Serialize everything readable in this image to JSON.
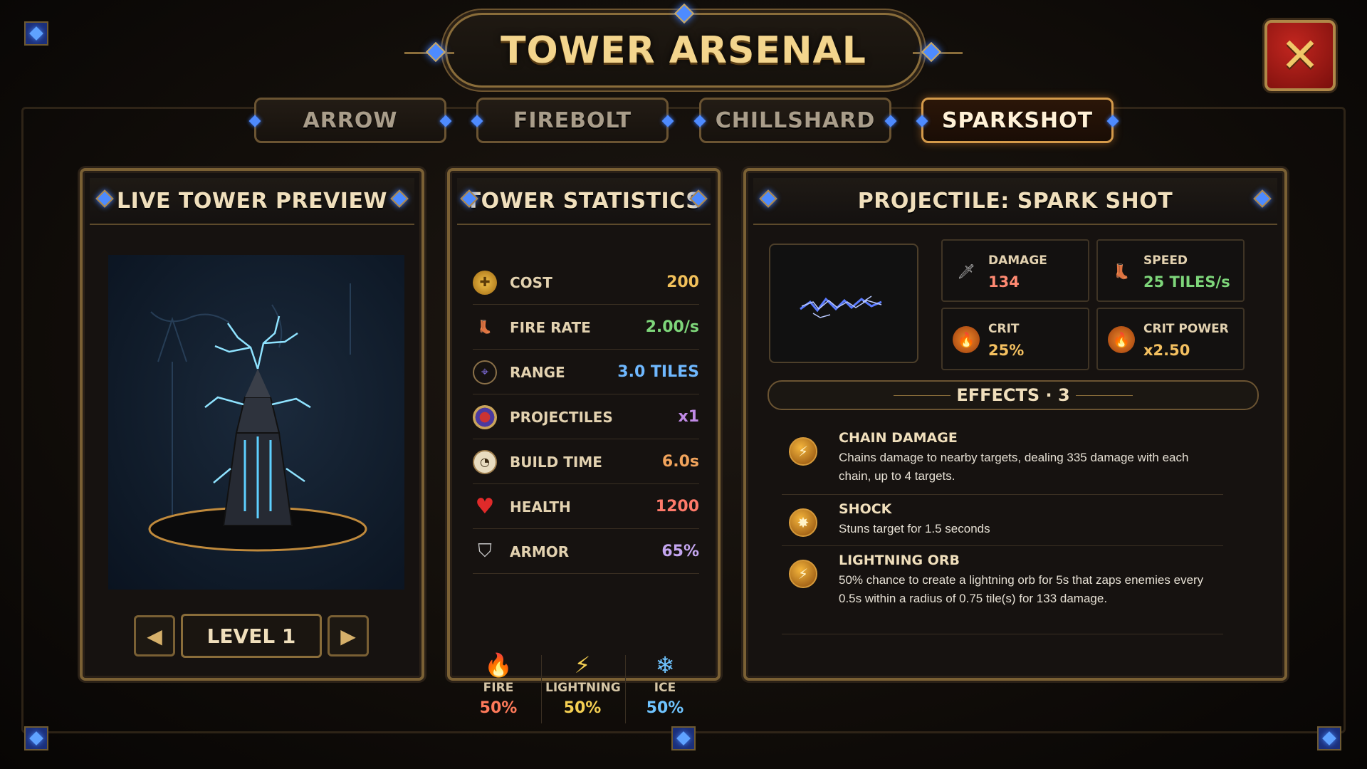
{
  "title": "TOWER ARSENAL",
  "close_icon": "close-icon",
  "tabs": [
    {
      "label": "ARROW",
      "active": false
    },
    {
      "label": "FIREBOLT",
      "active": false
    },
    {
      "label": "CHILLSHARD",
      "active": false
    },
    {
      "label": "SPARKSHOT",
      "active": true
    }
  ],
  "preview": {
    "title": "LIVE TOWER PREVIEW",
    "level_label": "LEVEL 1",
    "prev_icon": "arrow-left-icon",
    "next_icon": "arrow-right-icon"
  },
  "stats": {
    "title": "TOWER STATISTICS",
    "rows": [
      {
        "name": "COST",
        "value": "200",
        "color": "#f1c05a",
        "icon": "coin-icon"
      },
      {
        "name": "FIRE RATE",
        "value": "2.00/s",
        "color": "#7ed67a",
        "icon": "boot-icon"
      },
      {
        "name": "RANGE",
        "value": "3.0 TILES",
        "color": "#6fb8ff",
        "icon": "crosshair-icon"
      },
      {
        "name": "PROJECTILES",
        "value": "x1",
        "color": "#c08ae6",
        "icon": "target-icon"
      },
      {
        "name": "BUILD TIME",
        "value": "6.0s",
        "color": "#f2a45c",
        "icon": "stopwatch-icon"
      },
      {
        "name": "HEALTH",
        "value": "1200",
        "color": "#ff7a6a",
        "icon": "heart-icon"
      },
      {
        "name": "ARMOR",
        "value": "65%",
        "color": "#c4a6f0",
        "icon": "shield-icon"
      }
    ],
    "elements": [
      {
        "name": "FIRE",
        "value": "50%",
        "color": "#ff7a5a",
        "icon": "fire-icon"
      },
      {
        "name": "LIGHTNING",
        "value": "50%",
        "color": "#f4cf52",
        "icon": "lightning-icon"
      },
      {
        "name": "ICE",
        "value": "50%",
        "color": "#6fc4ff",
        "icon": "snowflake-icon"
      }
    ]
  },
  "projectile": {
    "title": "PROJECTILE: SPARK SHOT",
    "stats": [
      {
        "name": "DAMAGE",
        "value": "134",
        "color": "#ff8a72",
        "icon": "sword-icon"
      },
      {
        "name": "SPEED",
        "value": "25 TILES/s",
        "color": "#7ed67a",
        "icon": "boot-icon"
      },
      {
        "name": "CRIT",
        "value": "25%",
        "color": "#f4c060",
        "icon": "crit-icon"
      },
      {
        "name": "CRIT POWER",
        "value": "x2.50",
        "color": "#f4c060",
        "icon": "crit-power-icon"
      }
    ],
    "effects_title": "EFFECTS · 3",
    "effects": [
      {
        "name": "CHAIN DAMAGE",
        "desc": "Chains damage to nearby targets, dealing 335 damage with each chain, up to 4 targets.",
        "icon": "chain-lightning-icon"
      },
      {
        "name": "SHOCK",
        "desc": "Stuns target for 1.5 seconds",
        "icon": "shock-icon"
      },
      {
        "name": "LIGHTNING ORB",
        "desc": "50% chance to create a lightning orb for 5s that zaps enemies every 0.5s within a radius of 0.75 tile(s) for 133 damage.",
        "icon": "lightning-orb-icon"
      }
    ]
  }
}
